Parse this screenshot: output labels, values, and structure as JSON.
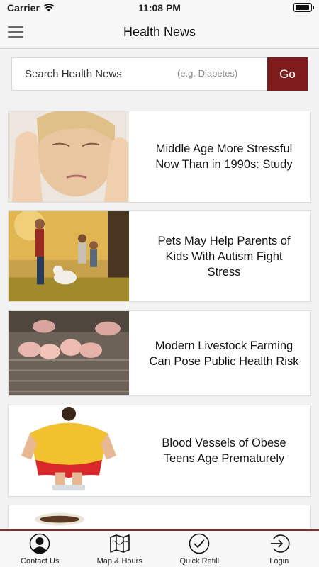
{
  "status_bar": {
    "carrier": "Carrier",
    "time": "11:08 PM"
  },
  "nav": {
    "title": "Health News",
    "menu_icon": "hamburger-menu-icon"
  },
  "search": {
    "placeholder": "Search Health News",
    "hint": "(e.g. Diabetes)",
    "go_label": "Go"
  },
  "news": [
    {
      "title": "Middle Age More Stressful Now Than in 1990s: Study"
    },
    {
      "title": "Pets May Help Parents of Kids With Autism Fight Stress"
    },
    {
      "title": "Modern Livestock Farming Can Pose Public Health Risk"
    },
    {
      "title": "Blood Vessels of Obese Teens Age Prematurely"
    },
    {
      "title": ""
    }
  ],
  "tabs": [
    {
      "label": "Contact Us",
      "icon": "person-icon"
    },
    {
      "label": "Map & Hours",
      "icon": "map-icon"
    },
    {
      "label": "Quick Refill",
      "icon": "checkmark-circle-icon"
    },
    {
      "label": "Login",
      "icon": "login-icon"
    }
  ],
  "colors": {
    "accent": "#7d1b1d",
    "nav_background": "#f7f7f7",
    "page_background": "#f2f2f2"
  }
}
